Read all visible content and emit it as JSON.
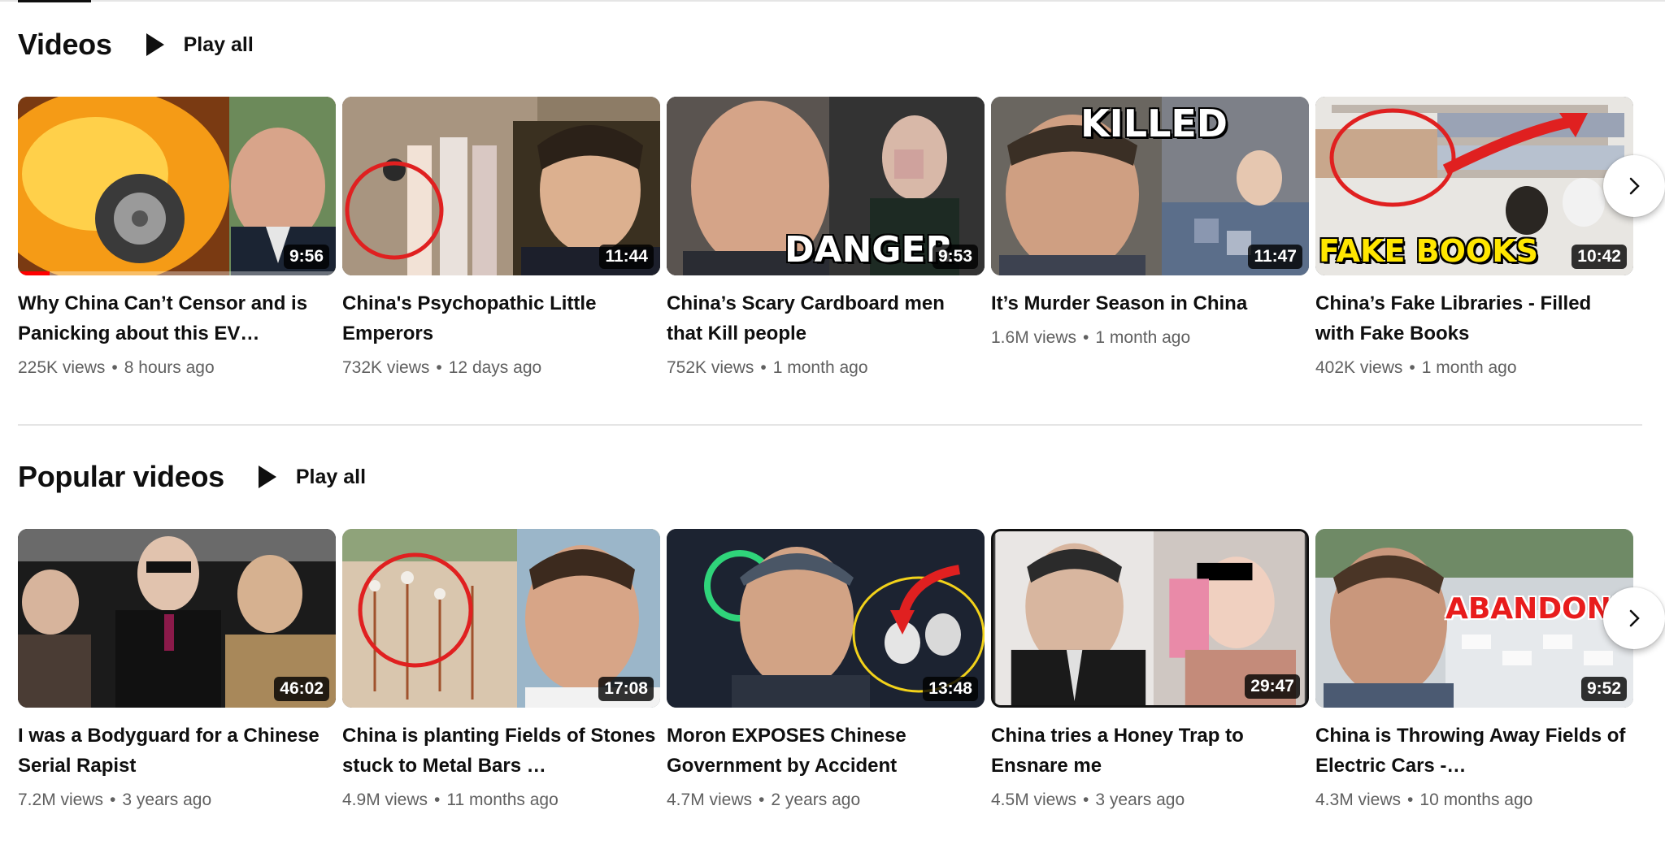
{
  "sections": [
    {
      "title": "Videos",
      "play_all": "Play all",
      "videos": [
        {
          "title": "Why China Can’t Censor and is Panicking about this EV…",
          "duration": "9:56",
          "views": "225K views",
          "age": "8 hours ago",
          "progress": 0.1,
          "overlay": ""
        },
        {
          "title": "China's Psychopathic Little Emperors",
          "duration": "11:44",
          "views": "732K views",
          "age": "12 days ago",
          "overlay": ""
        },
        {
          "title": "China’s Scary Cardboard men that Kill people",
          "duration": "9:53",
          "views": "752K views",
          "age": "1 month ago",
          "overlay": "DANGER"
        },
        {
          "title": "It’s Murder Season in China",
          "duration": "11:47",
          "views": "1.6M views",
          "age": "1 month ago",
          "overlay": "KILLED"
        },
        {
          "title": "China’s Fake Libraries - Filled with Fake Books",
          "duration": "10:42",
          "views": "402K views",
          "age": "1 month ago",
          "overlay": "FAKE BOOKS"
        }
      ]
    },
    {
      "title": "Popular videos",
      "play_all": "Play all",
      "videos": [
        {
          "title": "I was a Bodyguard for a Chinese Serial Rapist",
          "duration": "46:02",
          "views": "7.2M views",
          "age": "3 years ago",
          "overlay": ""
        },
        {
          "title": "China is planting Fields of Stones stuck to Metal Bars …",
          "duration": "17:08",
          "views": "4.9M views",
          "age": "11 months ago",
          "overlay": ""
        },
        {
          "title": "Moron EXPOSES Chinese Government by Accident",
          "duration": "13:48",
          "views": "4.7M views",
          "age": "2 years ago",
          "overlay": ""
        },
        {
          "title": "China tries a Honey Trap to Ensnare me",
          "duration": "29:47",
          "views": "4.5M views",
          "age": "3 years ago",
          "overlay": ""
        },
        {
          "title": "China is Throwing Away Fields of Electric Cars -…",
          "duration": "9:52",
          "views": "4.3M views",
          "age": "10 months ago",
          "overlay": "ABANDONE"
        }
      ]
    }
  ],
  "meta_separator": "•",
  "icons": {
    "play": "play-icon",
    "next": "chevron-right-icon"
  },
  "colors": {
    "progress": "#ff0000",
    "meta_text": "#606060",
    "title_text": "#0f0f0f"
  }
}
